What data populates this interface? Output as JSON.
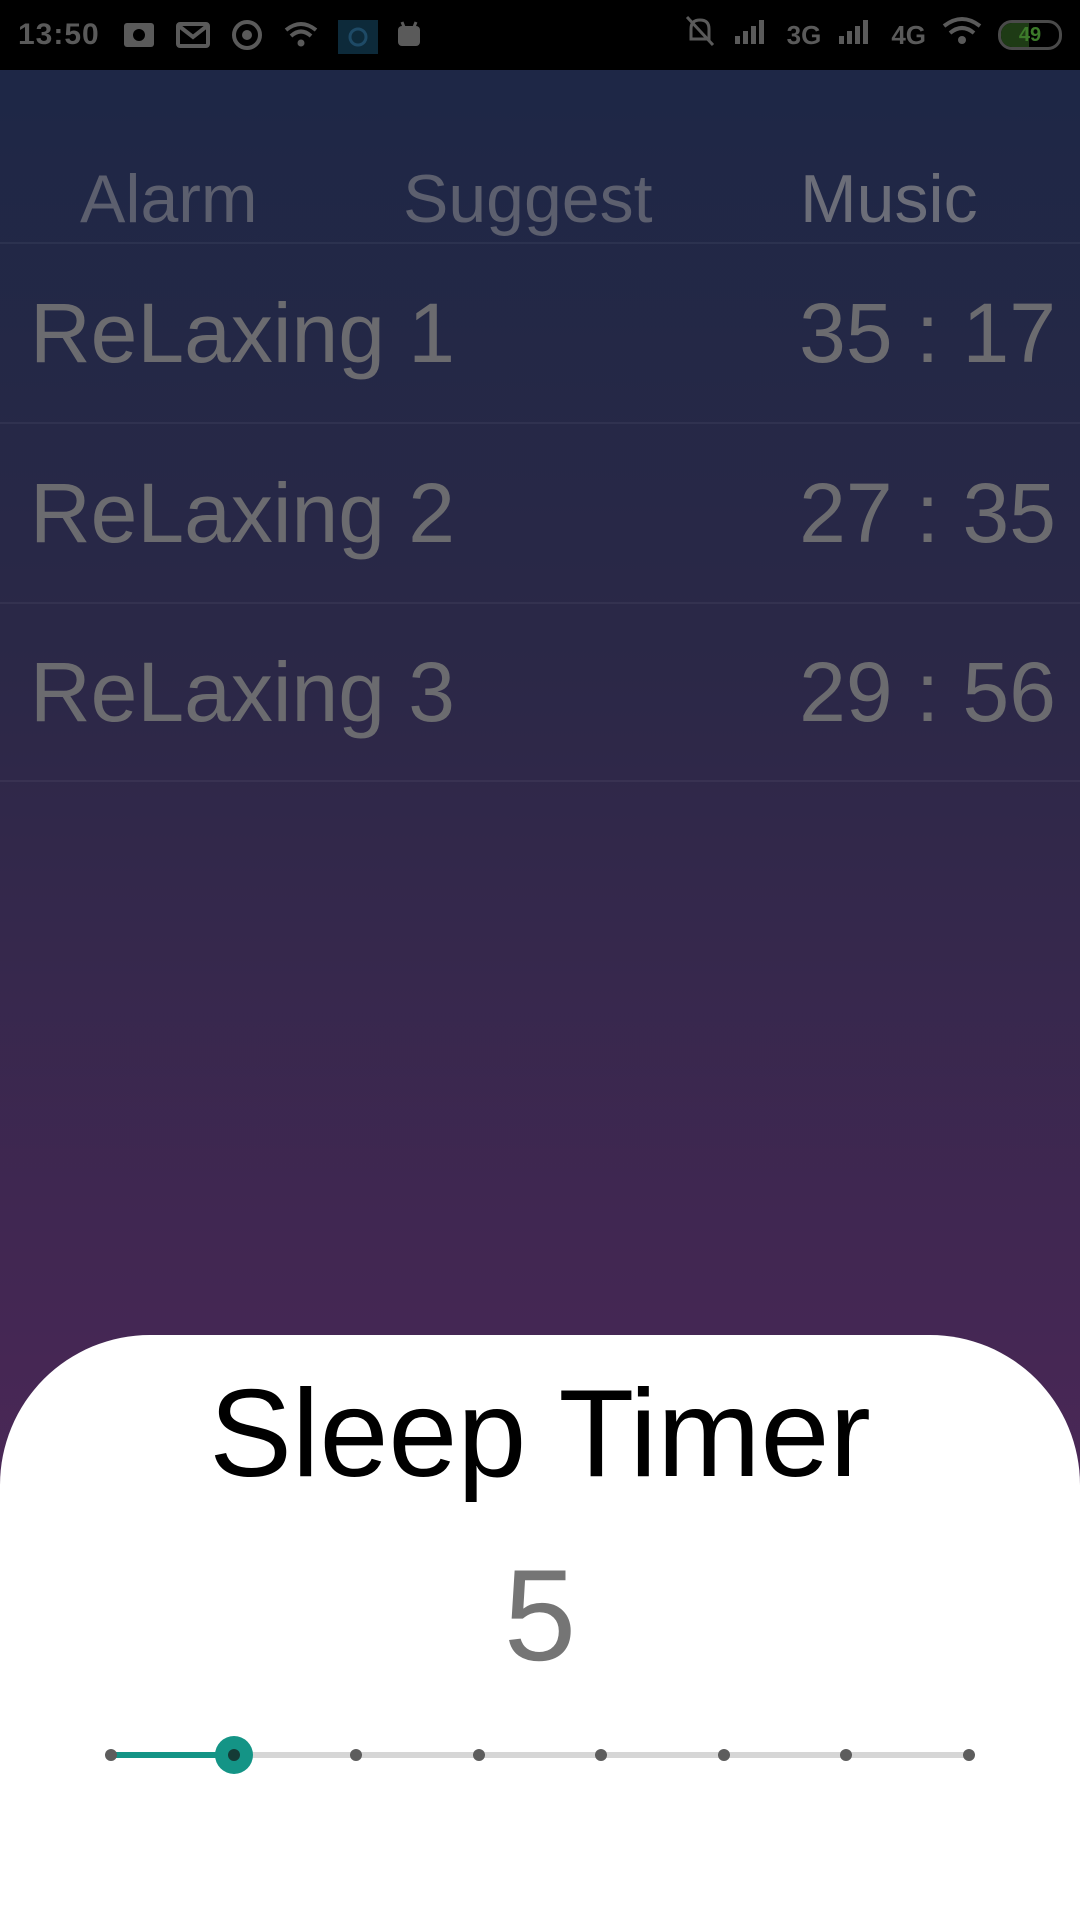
{
  "status_bar": {
    "time": "13:50",
    "network_3g": "3G",
    "network_4g": "4G",
    "battery": "49",
    "icons": [
      "photo-icon",
      "gmail-icon",
      "chrome-icon",
      "wifi-icon",
      "app-icon",
      "android-icon",
      "bell-mute-icon",
      "signal-icon",
      "wifi-icon",
      "battery-icon"
    ]
  },
  "tabs": [
    {
      "label": "Alarm"
    },
    {
      "label": "Suggest"
    },
    {
      "label": "Music"
    }
  ],
  "tracks": [
    {
      "title": "ReLaxing 1",
      "duration": "35 : 17"
    },
    {
      "title": "ReLaxing 2",
      "duration": "27 : 35"
    },
    {
      "title": "ReLaxing 3",
      "duration": "29 : 56"
    }
  ],
  "sleep_timer": {
    "title": "Sleep Timer",
    "value": "5",
    "slider_position": 1,
    "slider_steps": 8,
    "accent_color": "#149486"
  }
}
